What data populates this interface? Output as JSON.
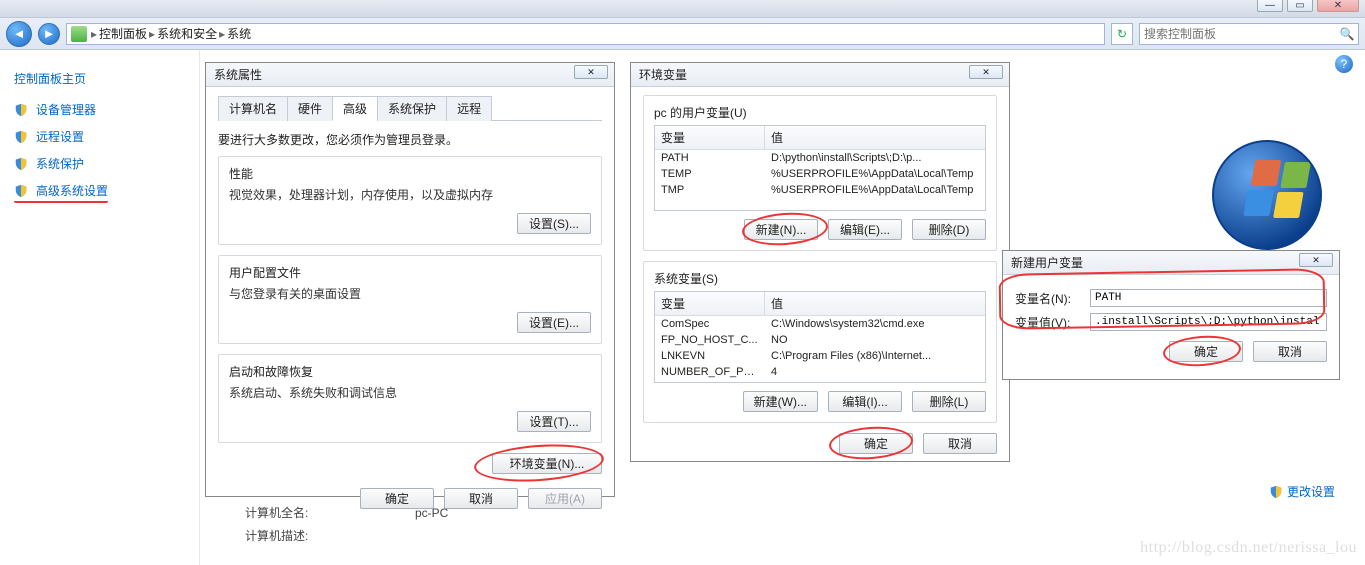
{
  "titlebar": {
    "min": "—",
    "max": "▭",
    "close": "✕"
  },
  "addr": {
    "crumb1": "控制面板",
    "crumb2": "系统和安全",
    "crumb3": "系统",
    "search_placeholder": "搜索控制面板"
  },
  "leftpanel": {
    "home": "控制面板主页",
    "items": [
      {
        "label": "设备管理器"
      },
      {
        "label": "远程设置"
      },
      {
        "label": "系统保护"
      },
      {
        "label": "高级系统设置"
      }
    ]
  },
  "change_settings": "更改设置",
  "info": {
    "full_name_label": "计算机全名:",
    "full_name_value": "pc-PC",
    "desc_label": "计算机描述:"
  },
  "sysprops": {
    "title": "系统属性",
    "tabs": {
      "t1": "计算机名",
      "t2": "硬件",
      "t3": "高级",
      "t4": "系统保护",
      "t5": "远程"
    },
    "banner": "要进行大多数更改，您必须作为管理员登录。",
    "perf_title": "性能",
    "perf_sub": "视觉效果，处理器计划，内存使用，以及虚拟内存",
    "perf_btn": "设置(S)...",
    "prof_title": "用户配置文件",
    "prof_sub": "与您登录有关的桌面设置",
    "prof_btn": "设置(E)...",
    "rec_title": "启动和故障恢复",
    "rec_sub": "系统启动、系统失败和调试信息",
    "rec_btn": "设置(T)...",
    "env_btn": "环境变量(N)...",
    "ok": "确定",
    "cancel": "取消",
    "apply": "应用(A)"
  },
  "envdlg": {
    "title": "环境变量",
    "user_group": "pc 的用户变量(U)",
    "col_var": "变量",
    "col_val": "值",
    "user_rows": [
      {
        "n": "PATH",
        "v": "D:\\python\\install\\Scripts\\;D:\\p..."
      },
      {
        "n": "TEMP",
        "v": "%USERPROFILE%\\AppData\\Local\\Temp"
      },
      {
        "n": "TMP",
        "v": "%USERPROFILE%\\AppData\\Local\\Temp"
      }
    ],
    "sys_group": "系统变量(S)",
    "sys_rows": [
      {
        "n": "ComSpec",
        "v": "C:\\Windows\\system32\\cmd.exe"
      },
      {
        "n": "FP_NO_HOST_C...",
        "v": "NO"
      },
      {
        "n": "LNKEVN",
        "v": "C:\\Program Files (x86)\\Internet..."
      },
      {
        "n": "NUMBER_OF_PR...",
        "v": "4"
      }
    ],
    "new": "新建(N)...",
    "edit": "编辑(E)...",
    "del_u": "删除(D)",
    "new_s": "新建(W)...",
    "edit_s": "编辑(I)...",
    "del_s": "删除(L)",
    "ok": "确定",
    "cancel": "取消"
  },
  "newvar": {
    "title": "新建用户变量",
    "name_label": "变量名(N):",
    "name_value": "PATH",
    "val_label": "变量值(V):",
    "val_value": ".install\\Scripts\\;D:\\python\\install\\",
    "ok": "确定",
    "cancel": "取消"
  },
  "watermark": "http://blog.csdn.net/nerissa_lou"
}
